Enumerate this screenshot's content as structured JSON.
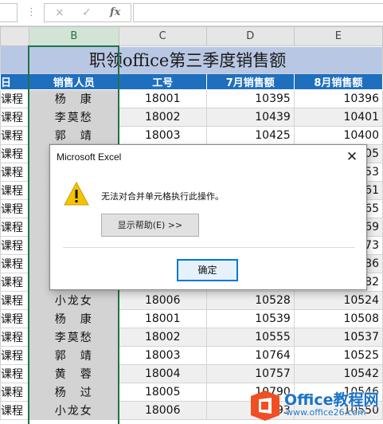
{
  "formula_bar": {
    "cancel_icon": "×",
    "enter_icon": "✓",
    "fx_label": "fx",
    "grip": "⋮",
    "formula_value": ""
  },
  "sheet": {
    "column_headers": [
      "B",
      "C",
      "D",
      "E"
    ],
    "selected_column": "B",
    "title": "职领office第三季度销售额",
    "table_headers": [
      "日",
      "销售人员",
      "工号",
      "7月销售额",
      "8月销售额"
    ],
    "rows": [
      {
        "a": "课程",
        "b": "杨　康",
        "c": "18001",
        "d": "10395",
        "e": "10396"
      },
      {
        "a": "课程",
        "b": "李莫愁",
        "c": "18002",
        "d": "10439",
        "e": "10401"
      },
      {
        "a": "课程",
        "b": "郭　靖",
        "c": "18003",
        "d": "10425",
        "e": "10400"
      },
      {
        "a": "课程",
        "b": "",
        "c": "",
        "d": "",
        "e": "405"
      },
      {
        "a": "课程",
        "b": "",
        "c": "",
        "d": "",
        "e": "453"
      },
      {
        "a": "课程",
        "b": "",
        "c": "",
        "d": "",
        "e": "461"
      },
      {
        "a": "课程",
        "b": "",
        "c": "",
        "d": "",
        "e": "465"
      },
      {
        "a": "课程",
        "b": "",
        "c": "",
        "d": "",
        "e": "469"
      },
      {
        "a": "课程",
        "b": "",
        "c": "",
        "d": "",
        "e": "473"
      },
      {
        "a": "课程",
        "b": "",
        "c": "",
        "d": "",
        "e": "486"
      },
      {
        "a": "课程",
        "b": "",
        "c": "",
        "d": "",
        "e": "482"
      },
      {
        "a": "课程",
        "b": "小龙女",
        "c": "18006",
        "d": "10528",
        "e": "10524"
      },
      {
        "a": "课程",
        "b": "杨　康",
        "c": "18001",
        "d": "10539",
        "e": "10508"
      },
      {
        "a": "课程",
        "b": "李莫愁",
        "c": "18002",
        "d": "10555",
        "e": "10537"
      },
      {
        "a": "课程",
        "b": "郭　靖",
        "c": "18003",
        "d": "10764",
        "e": "10525"
      },
      {
        "a": "课程",
        "b": "黄　蓉",
        "c": "18004",
        "d": "10757",
        "e": "10542"
      },
      {
        "a": "课程",
        "b": "杨　过",
        "c": "18005",
        "d": "10790",
        "e": "10546"
      },
      {
        "a": "课程",
        "b": "小龙女",
        "c": "18006",
        "d": "10893",
        "e": "10550"
      }
    ]
  },
  "dialog": {
    "title": "Microsoft Excel",
    "close_icon": "✕",
    "icon": "warning-icon",
    "message": "无法对合并单元格执行此操作。",
    "help_button": "显示帮助(E) >>",
    "ok_button": "确定"
  },
  "watermark": {
    "name": "Office教程网",
    "url": "www.office26.com"
  },
  "colors": {
    "accent_green": "#217346",
    "title_band": "#b8c7e3",
    "header_blue": "#1f6fbf",
    "dialog_focus": "#0078d7",
    "warning_yellow": "#f5c400"
  }
}
